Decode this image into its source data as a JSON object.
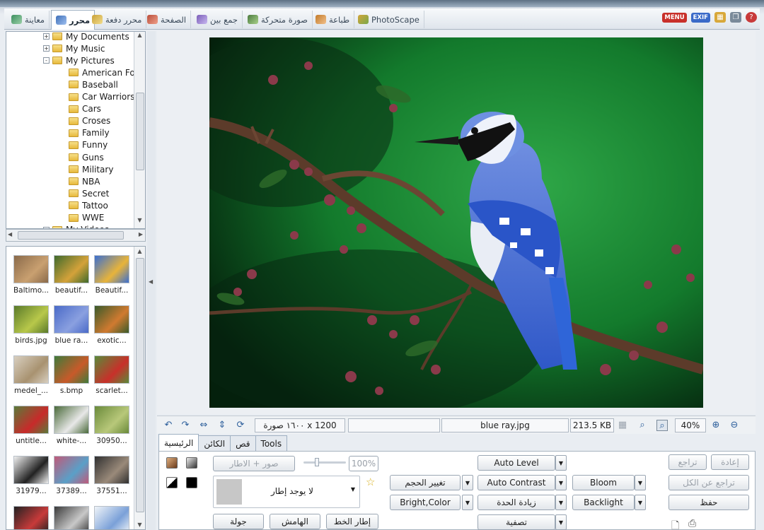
{
  "tabs": [
    {
      "label": "معاينة",
      "icon": "viewer-icon",
      "color": "#3d8f5f"
    },
    {
      "label": "محرر",
      "icon": "editor-icon",
      "color": "#3e6fb8"
    },
    {
      "label": "محرر دفعة",
      "icon": "batch-editor-icon",
      "color": "#c9a23a"
    },
    {
      "label": "الصفحة",
      "icon": "page-icon",
      "color": "#b94d3a"
    },
    {
      "label": "جمع بين",
      "icon": "combine-icon",
      "color": "#7a5db8"
    },
    {
      "label": "صورة متحركة",
      "icon": "animated-gif-icon",
      "color": "#4b7b3f"
    },
    {
      "label": "طباعة",
      "icon": "print-icon",
      "color": "#c27a2a"
    },
    {
      "label": "PhotoScape",
      "icon": "photoscape-icon",
      "color": "#d2a63a"
    }
  ],
  "top_icons": {
    "menu": "MENU",
    "exif": "EXIF"
  },
  "tree": {
    "items": [
      {
        "label": "My Documents",
        "level": 1,
        "expander": "+"
      },
      {
        "label": "My Music",
        "level": 1,
        "expander": "+"
      },
      {
        "label": "My Pictures",
        "level": 1,
        "expander": "-"
      },
      {
        "label": "American Fo",
        "level": 2
      },
      {
        "label": "Baseball",
        "level": 2
      },
      {
        "label": "Car Warriors",
        "level": 2
      },
      {
        "label": "Cars",
        "level": 2
      },
      {
        "label": "Croses",
        "level": 2
      },
      {
        "label": "Family",
        "level": 2
      },
      {
        "label": "Funny",
        "level": 2
      },
      {
        "label": "Guns",
        "level": 2
      },
      {
        "label": "Military",
        "level": 2
      },
      {
        "label": "NBA",
        "level": 2
      },
      {
        "label": "Secret",
        "level": 2
      },
      {
        "label": "Tattoo",
        "level": 2
      },
      {
        "label": "WWE",
        "level": 2
      },
      {
        "label": "My Videos",
        "level": 1,
        "expander": "+"
      }
    ]
  },
  "thumbnails": [
    {
      "name": "Baltimo...",
      "c1": "#8a6a4a",
      "c2": "#c9a070"
    },
    {
      "name": "beautif...",
      "c1": "#3f6a2c",
      "c2": "#d4a23a"
    },
    {
      "name": "Beautif...",
      "c1": "#3b6fd0",
      "c2": "#e8b43a"
    },
    {
      "name": "birds.jpg",
      "c1": "#5a7a2a",
      "c2": "#b8c84a"
    },
    {
      "name": "blue ra...",
      "c1": "#4a6ac8",
      "c2": "#8aa0e0"
    },
    {
      "name": "exotic...",
      "c1": "#3a5a2a",
      "c2": "#d07a30"
    },
    {
      "name": "medel_...",
      "c1": "#d8cfc0",
      "c2": "#a89270"
    },
    {
      "name": "s.bmp",
      "c1": "#3f7a3a",
      "c2": "#c85a2a"
    },
    {
      "name": "scarlet...",
      "c1": "#5a8a3a",
      "c2": "#c8302a"
    },
    {
      "name": "untitle...",
      "c1": "#5a7a3a",
      "c2": "#c82a2a"
    },
    {
      "name": "white-...",
      "c1": "#4a6a3a",
      "c2": "#e8e8e8"
    },
    {
      "name": "30950...",
      "c1": "#6a8a3a",
      "c2": "#b8c87a"
    },
    {
      "name": "31979...",
      "c1": "#f0f0f0",
      "c2": "#222222"
    },
    {
      "name": "37389...",
      "c1": "#c05a7a",
      "c2": "#5aa0c8"
    },
    {
      "name": "37551...",
      "c1": "#303030",
      "c2": "#9a8a7a"
    },
    {
      "name": "",
      "c1": "#222222",
      "c2": "#c83a3a"
    },
    {
      "name": "",
      "c1": "#3a3a3a",
      "c2": "#c8c8c8"
    },
    {
      "name": "",
      "c1": "#f0f4f8",
      "c2": "#7aa0d8"
    }
  ],
  "status": {
    "dimensions": "١٦٠٠ صورة x 1200",
    "filename": "blue ray.jpg",
    "filesize": "213.5 KB",
    "zoom": "40%"
  },
  "editor_tabs": [
    {
      "label": "الرئيسية",
      "active": true
    },
    {
      "label": "الكائن",
      "active": false
    },
    {
      "label": "قص",
      "active": false
    },
    {
      "label": "Tools",
      "active": false
    }
  ],
  "home": {
    "photo_frame_btn": "صور + الاطار",
    "opacity": "100%",
    "frame_select": "لا يوجد إطار",
    "btn_round": "جولة",
    "btn_margin": "الهامش",
    "btn_line_frame": "إطار الخط",
    "resize": "تغيير الحجم",
    "bright_color": "Bright,Color",
    "auto_level": "Auto Level",
    "auto_contrast": "Auto Contrast",
    "sharpen": "زيادة الحدة",
    "filter": "تصفية",
    "bloom": "Bloom",
    "backlight": "Backlight",
    "undo": "تراجع",
    "redo": "إعادة",
    "undo_all": "تراجع عن الكل",
    "save": "حفظ"
  }
}
